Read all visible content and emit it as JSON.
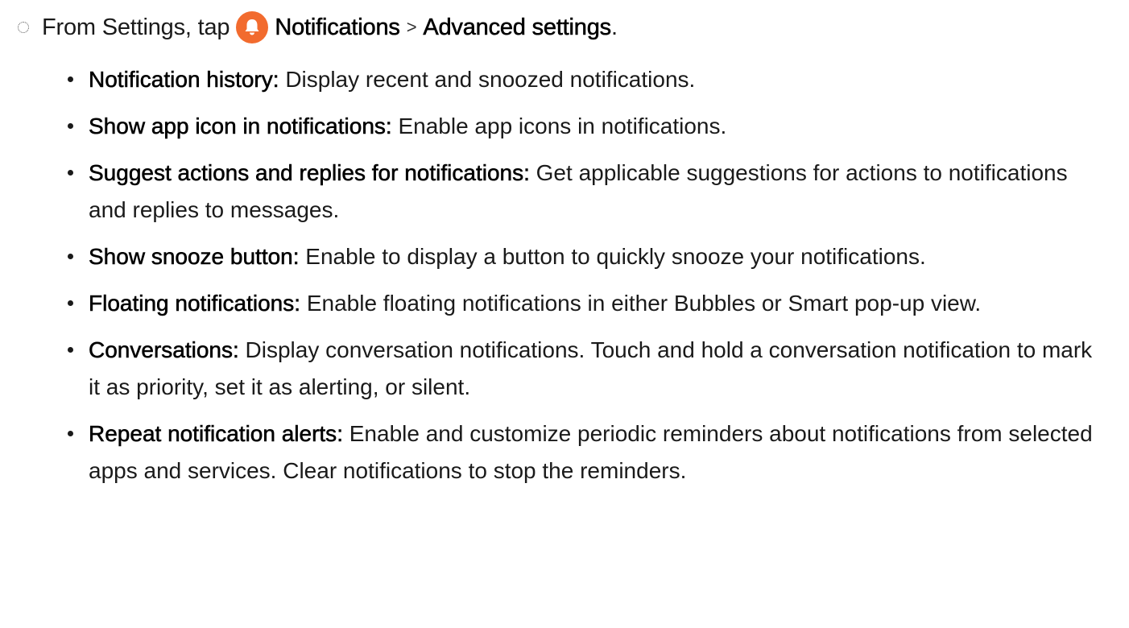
{
  "step": {
    "prefix": "From Settings, tap",
    "icon": "notification-bell-icon",
    "icon_color": "#f26b2e",
    "link1": "Notifications",
    "separator": ">",
    "link2": "Advanced settings",
    "suffix": "."
  },
  "items": [
    {
      "term": "Notification history",
      "colon": ":",
      "desc": " Display recent and snoozed notifications."
    },
    {
      "term": "Show app icon in notifications",
      "colon": ":",
      "desc": " Enable app icons in notifications."
    },
    {
      "term": "Suggest actions and replies for notifications",
      "colon": ":",
      "desc": " Get applicable suggestions for actions to notifications and replies to messages."
    },
    {
      "term": "Show snooze button",
      "colon": ":",
      "desc": " Enable to display a button to quickly snooze your notifications."
    },
    {
      "term": "Floating notifications",
      "colon": ":",
      "desc": " Enable floating notifications in either Bubbles or Smart pop-up view."
    },
    {
      "term": "Conversations",
      "colon": ":",
      "desc": " Display conversation notifications. Touch and hold a conversation notification to mark it as priority, set it as alerting, or silent."
    },
    {
      "term": "Repeat notification alerts",
      "colon": ":",
      "desc": " Enable and customize periodic reminders about notifications from selected apps and services. Clear notifications to stop the reminders."
    }
  ]
}
